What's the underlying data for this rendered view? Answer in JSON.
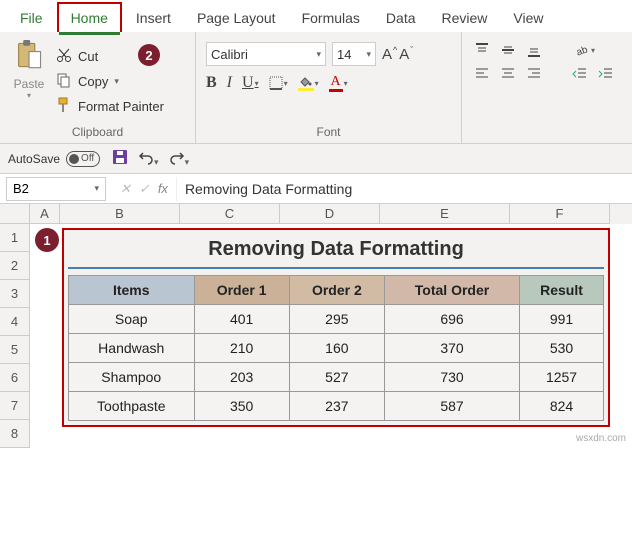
{
  "menu": {
    "file": "File",
    "home": "Home",
    "insert": "Insert",
    "pagelayout": "Page Layout",
    "formulas": "Formulas",
    "data": "Data",
    "review": "Review",
    "view": "View"
  },
  "ribbon": {
    "clipboard": {
      "paste": "Paste",
      "cut": "Cut",
      "copy": "Copy",
      "format_painter": "Format Painter",
      "group": "Clipboard"
    },
    "font": {
      "name": "Calibri",
      "size": "14",
      "bold": "B",
      "italic": "I",
      "underline": "U",
      "incA": "A",
      "decA": "A",
      "fontcolor": "A",
      "group": "Font"
    }
  },
  "markers": {
    "m1": "1",
    "m2": "2"
  },
  "qat": {
    "autosave": "AutoSave",
    "off": "Off"
  },
  "namebox": "B2",
  "fb_fx": "fx",
  "formula_value": "Removing Data Formatting",
  "cols": {
    "A": "A",
    "B": "B",
    "C": "C",
    "D": "D",
    "E": "E",
    "F": "F"
  },
  "rowlabels": {
    "r1": "1",
    "r2": "2",
    "r3": "3",
    "r4": "4",
    "r5": "5",
    "r6": "6",
    "r7": "7",
    "r8": "8"
  },
  "chart_data": {
    "type": "table",
    "title": "Removing Data Formatting",
    "columns": [
      "Items",
      "Order 1",
      "Order 2",
      "Total Order",
      "Result"
    ],
    "rows": [
      {
        "item": "Soap",
        "o1": "401",
        "o2": "295",
        "tot": "696",
        "res": "991"
      },
      {
        "item": "Handwash",
        "o1": "210",
        "o2": "160",
        "tot": "370",
        "res": "530"
      },
      {
        "item": "Shampoo",
        "o1": "203",
        "o2": "527",
        "tot": "730",
        "res": "1257"
      },
      {
        "item": "Toothpaste",
        "o1": "350",
        "o2": "237",
        "tot": "587",
        "res": "824"
      }
    ]
  },
  "watermark": "wsxdn.com"
}
